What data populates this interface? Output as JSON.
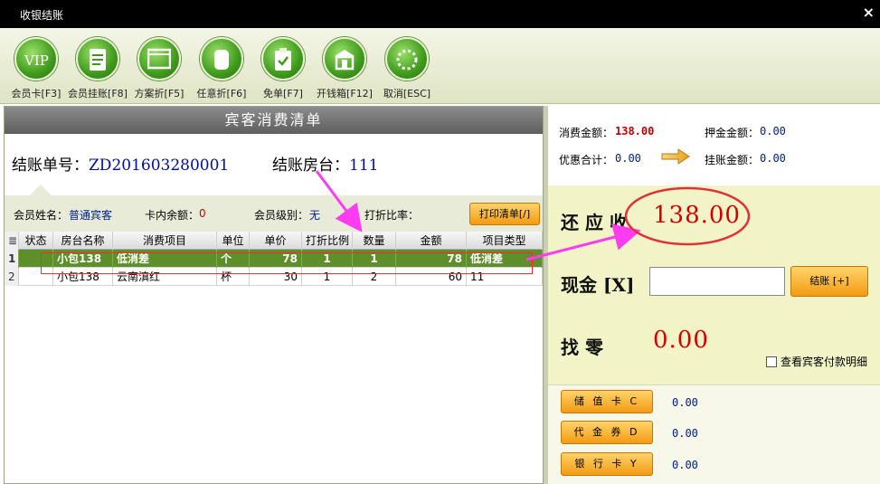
{
  "window": {
    "title": "收银结账",
    "close_glyph": "×"
  },
  "toolbar": [
    {
      "label": "会员卡[F3]",
      "icon": "vip-icon"
    },
    {
      "label": "会员挂账[F8]",
      "icon": "document-icon"
    },
    {
      "label": "方案折[F5]",
      "icon": "window-icon"
    },
    {
      "label": "任意折[F6]",
      "icon": "paper-roll-icon"
    },
    {
      "label": "免单[F7]",
      "icon": "clipboard-check-icon"
    },
    {
      "label": "开钱箱[F12]",
      "icon": "cashbox-icon"
    },
    {
      "label": "取消[ESC]",
      "icon": "loading-circle-icon"
    }
  ],
  "left": {
    "title": "宾客消费清单",
    "bill_label": "结账单号：",
    "bill_no": "ZD201603280001",
    "room_label": "结账房台：",
    "room_no": "111",
    "member_name_label": "会员姓名：",
    "member_name": "普通宾客",
    "card_balance_label": "卡内余额：",
    "card_balance": "0",
    "member_level_label": "会员级别：",
    "member_level": "无",
    "discount_label": "打折比率：",
    "print_button": "打印清单[/]"
  },
  "table": {
    "header_corner": "≣",
    "columns": [
      "状态",
      "房台名称",
      "消费项目",
      "单位",
      "单价",
      "打折比例",
      "数量",
      "金额",
      "项目类型"
    ],
    "rows": [
      {
        "n": "1",
        "status": "",
        "room": "小包138",
        "item": "低消差",
        "unit": "个",
        "price": "78",
        "disc": "1",
        "qty": "1",
        "amount": "78",
        "type": "低消差"
      },
      {
        "n": "2",
        "status": "",
        "room": "小包138",
        "item": "云南滇红",
        "unit": "杯",
        "price": "30",
        "disc": "1",
        "qty": "2",
        "amount": "60",
        "type": "11"
      }
    ]
  },
  "summary": {
    "consume_label": "消费金额：",
    "consume_value": "138.00",
    "deposit_label": "押金金额：",
    "deposit_value": "0.00",
    "discount_total_label": "优惠合计：",
    "discount_total_value": "0.00",
    "credit_label": "挂账金额：",
    "credit_value": "0.00"
  },
  "due": {
    "label": "还 应 收",
    "value": "138.00",
    "cash_label": "现金 [X]",
    "cash_input": "",
    "checkout_button": "结账 [+]",
    "change_label": "找    零",
    "change_value": "0.00",
    "detail_checkbox": "查看宾客付款明细"
  },
  "payments": [
    {
      "label": "储 值 卡 C",
      "value": "0.00"
    },
    {
      "label": "代 金 券 D",
      "value": "0.00"
    },
    {
      "label": "银 行 卡 Y",
      "value": "0.00"
    }
  ],
  "colors": {
    "selected_row": "#5e8f2b",
    "accent_red": "#d40000",
    "button_orange": "#f29b12",
    "annotation_arrow": "#ff3cf0"
  }
}
